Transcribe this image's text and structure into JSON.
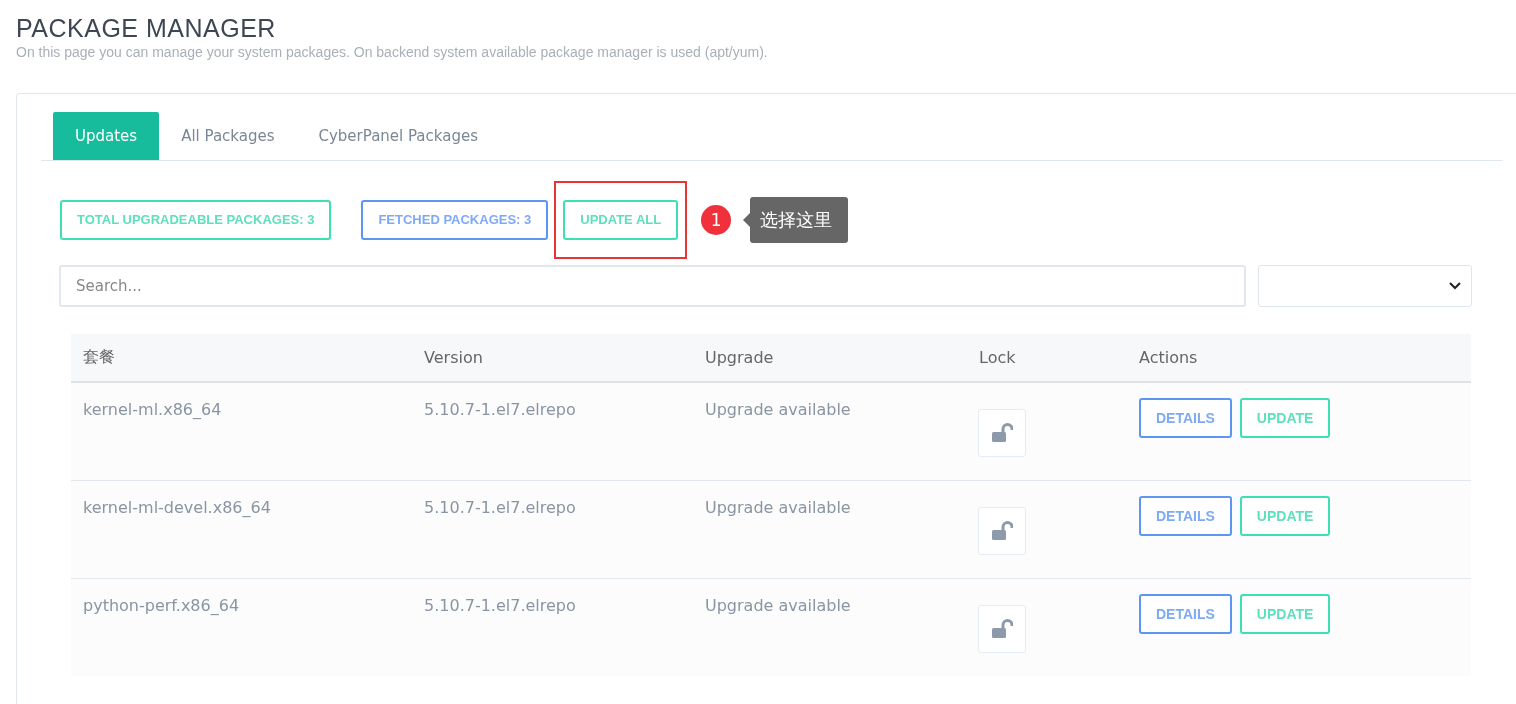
{
  "page": {
    "title": "PACKAGE MANAGER",
    "subtitle": "On this page you can manage your system packages. On backend system available package manager is used (apt/yum)."
  },
  "tabs": [
    {
      "label": "Updates",
      "selected": true
    },
    {
      "label": "All Packages",
      "selected": false
    },
    {
      "label": "CyberPanel Packages",
      "selected": false
    }
  ],
  "stats": [
    {
      "label": "TOTAL UPGRADEABLE PACKAGES: 3",
      "kind": "info",
      "highlighted": false
    },
    {
      "label": "FETCHED PACKAGES: 3",
      "kind": "count",
      "highlighted": false
    },
    {
      "label": "UPDATE ALL",
      "kind": "action",
      "highlighted": true
    }
  ],
  "annotation": {
    "number": "1",
    "text": "选择这里"
  },
  "search": {
    "placeholder": "Search..."
  },
  "table": {
    "columns": [
      "套餐",
      "Version",
      "Upgrade",
      "Lock",
      "Actions"
    ],
    "rows": [
      {
        "package": "kernel-ml.x86_64",
        "version": "5.10.7-1.el7.elrepo",
        "upgrade": "Upgrade available",
        "locked": false,
        "actions": [
          "DETAILS",
          "UPDATE"
        ]
      },
      {
        "package": "kernel-ml-devel.x86_64",
        "version": "5.10.7-1.el7.elrepo",
        "upgrade": "Upgrade available",
        "locked": false,
        "actions": [
          "DETAILS",
          "UPDATE"
        ]
      },
      {
        "package": "python-perf.x86_64",
        "version": "5.10.7-1.el7.elrepo",
        "upgrade": "Upgrade available",
        "locked": false,
        "actions": [
          "DETAILS",
          "UPDATE"
        ]
      }
    ]
  }
}
